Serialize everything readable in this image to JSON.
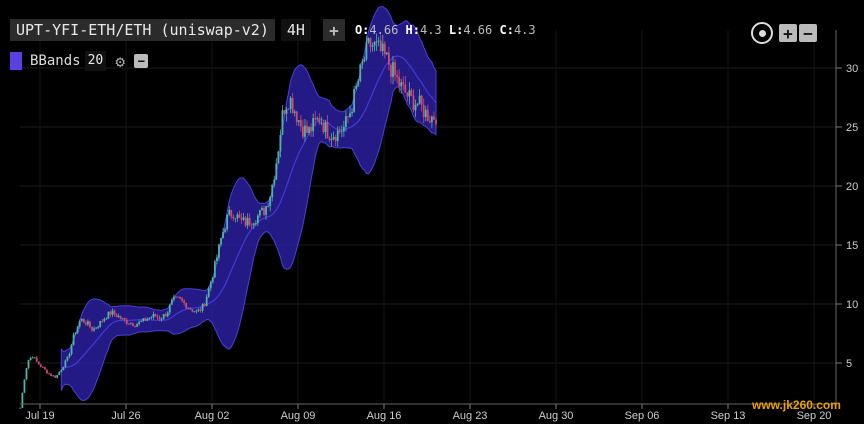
{
  "header": {
    "symbol": "UPT-YFI-ETH/ETH (uniswap-v2)",
    "interval": "4H",
    "ohlc": {
      "o_label": "O:",
      "o": "4.66",
      "h_label": "H:",
      "h": "4.3",
      "l_label": "L:",
      "l": "4.66",
      "c_label": "C:",
      "c": "4.3"
    },
    "indicator_name": "BBands",
    "indicator_period": "20"
  },
  "watermark": "www.jk260.com",
  "colors": {
    "band_fill": "#2a1f9c",
    "up": "#4fb3a6",
    "down": "#d04a6a",
    "swatch": "#5b3fe0"
  },
  "chart_data": {
    "type": "candlestick",
    "indicator": "Bollinger Bands (20)",
    "x_ticks": [
      "Jul 19",
      "Jul 26",
      "Aug 02",
      "Aug 09",
      "Aug 16",
      "Aug 23",
      "Aug 30",
      "Sep 06",
      "Sep 13",
      "Sep 20"
    ],
    "y_ticks": [
      5,
      10,
      15,
      20,
      25,
      30
    ],
    "ylim": [
      0,
      33.5
    ],
    "x_day_range": [
      -2,
      19.9
    ],
    "close_path": [
      [
        -1.6,
        1.2
      ],
      [
        -1.3,
        3.5
      ],
      [
        -1.0,
        5.2
      ],
      [
        -0.6,
        5.6
      ],
      [
        -0.2,
        5.0
      ],
      [
        0.3,
        4.5
      ],
      [
        0.8,
        4.0
      ],
      [
        1.3,
        3.8
      ],
      [
        1.8,
        4.6
      ],
      [
        2.3,
        5.5
      ],
      [
        2.8,
        7.5
      ],
      [
        3.3,
        8.7
      ],
      [
        3.8,
        8.4
      ],
      [
        4.3,
        7.8
      ],
      [
        4.8,
        8.3
      ],
      [
        5.3,
        8.9
      ],
      [
        5.8,
        9.3
      ],
      [
        6.3,
        9.0
      ],
      [
        6.8,
        8.6
      ],
      [
        7.3,
        8.4
      ],
      [
        7.8,
        8.3
      ],
      [
        8.3,
        8.5
      ],
      [
        8.8,
        8.8
      ],
      [
        9.3,
        9.0
      ],
      [
        9.8,
        8.8
      ],
      [
        10.3,
        9.2
      ],
      [
        10.8,
        10.3
      ],
      [
        11.3,
        10.4
      ],
      [
        11.8,
        10.0
      ],
      [
        12.3,
        9.6
      ],
      [
        12.8,
        9.3
      ],
      [
        13.3,
        9.8
      ],
      [
        13.8,
        11.5
      ],
      [
        14.3,
        13.5
      ],
      [
        14.8,
        15.8
      ],
      [
        15.3,
        17.5
      ],
      [
        15.8,
        17.8
      ],
      [
        16.3,
        17.0
      ],
      [
        16.8,
        16.9
      ],
      [
        17.3,
        17.2
      ],
      [
        17.8,
        17.5
      ],
      [
        18.3,
        18.0
      ],
      [
        18.8,
        19.5
      ],
      [
        19.3,
        22.5
      ],
      [
        19.8,
        26.5
      ],
      [
        20.3,
        27.5
      ],
      [
        20.8,
        26.3
      ],
      [
        21.3,
        25.0
      ],
      [
        21.8,
        24.5
      ],
      [
        22.3,
        25.2
      ],
      [
        22.8,
        25.8
      ],
      [
        23.3,
        24.7
      ],
      [
        23.8,
        24.4
      ],
      [
        24.3,
        24.6
      ],
      [
        24.8,
        25.0
      ],
      [
        25.3,
        26.5
      ],
      [
        25.8,
        28.5
      ],
      [
        26.3,
        30.5
      ],
      [
        26.8,
        32.0
      ],
      [
        27.3,
        31.8
      ],
      [
        27.8,
        31.3
      ],
      [
        28.3,
        30.6
      ],
      [
        28.8,
        29.5
      ],
      [
        29.3,
        28.5
      ],
      [
        29.8,
        27.8
      ],
      [
        30.3,
        27.2
      ],
      [
        30.8,
        27.0
      ],
      [
        31.3,
        26.3
      ],
      [
        31.8,
        25.8
      ],
      [
        32.3,
        26.0
      ]
    ]
  }
}
